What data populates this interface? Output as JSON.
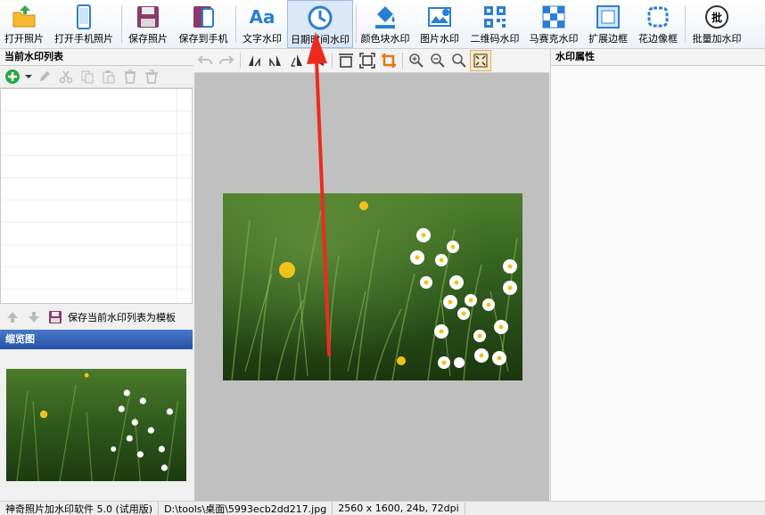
{
  "toolbar": {
    "open_photo": "打开照片",
    "open_phone_photo": "打开手机照片",
    "save_photo": "保存照片",
    "save_to_phone": "保存到手机",
    "text_watermark": "文字水印",
    "text_icon_glyph": "Aa",
    "datetime_watermark": "日期时间水印",
    "color_block_watermark": "颜色块水印",
    "image_watermark": "图片水印",
    "qrcode_watermark": "二维码水印",
    "mosaic_watermark": "马赛克水印",
    "expand_border": "扩展边框",
    "fancy_border": "花边像框",
    "batch_watermark": "批量加水印",
    "batch_icon_glyph": "批"
  },
  "left_panel": {
    "title": "当前水印列表",
    "save_template": "保存当前水印列表为模板",
    "thumbnail_title": "缩览图"
  },
  "right_panel": {
    "title": "水印属性"
  },
  "status": {
    "app": "神奇照片加水印软件 5.0 (试用版)",
    "path": "D:\\tools\\桌面\\5993ecb2dd217.jpg",
    "info": "2560 x 1600, 24b, 72dpi"
  },
  "colors": {
    "accent": "#2a7fd4",
    "arrow": "#ee2a1e",
    "canvas_bg": "#c0c0c0",
    "thumb_title_bg": "#2552a8"
  }
}
